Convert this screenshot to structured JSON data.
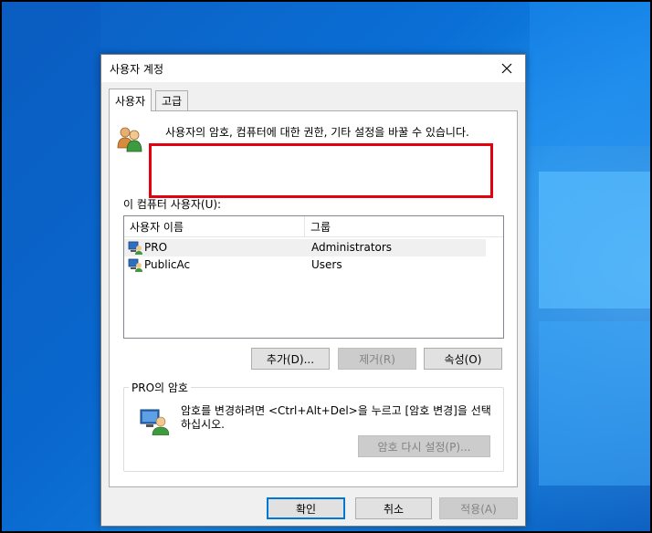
{
  "dialog": {
    "title": "사용자 계정",
    "close_icon": "close-icon"
  },
  "tabs": [
    {
      "label": "사용자",
      "active": true
    },
    {
      "label": "고급",
      "active": false
    }
  ],
  "intro": {
    "text": "사용자의 암호, 컴퓨터에 대한 권한, 기타 설정을 바꿀 수 있습니다.",
    "icon": "users-icon"
  },
  "highlight_color": "#e3000f",
  "users_list": {
    "label": "이 컴퓨터 사용자(U):",
    "columns": [
      "사용자 이름",
      "그룹"
    ],
    "rows": [
      {
        "name": "PRO",
        "group": "Administrators",
        "selected": true
      },
      {
        "name": "PublicAc",
        "group": "Users",
        "selected": false
      }
    ]
  },
  "list_buttons": {
    "add": "추가(D)...",
    "remove": "제거(R)",
    "properties": "속성(O)"
  },
  "password_group": {
    "title": "PRO의 암호",
    "text": "암호를 변경하려면 <Ctrl+Alt+Del>을 누르고 [암호 변경]을 선택하십시오.",
    "reset_button": "암호 다시 설정(P)..."
  },
  "footer_buttons": {
    "ok": "확인",
    "cancel": "취소",
    "apply": "적용(A)"
  },
  "colors": {
    "accent": "#0078d7",
    "desktop": "#0a67c9"
  }
}
